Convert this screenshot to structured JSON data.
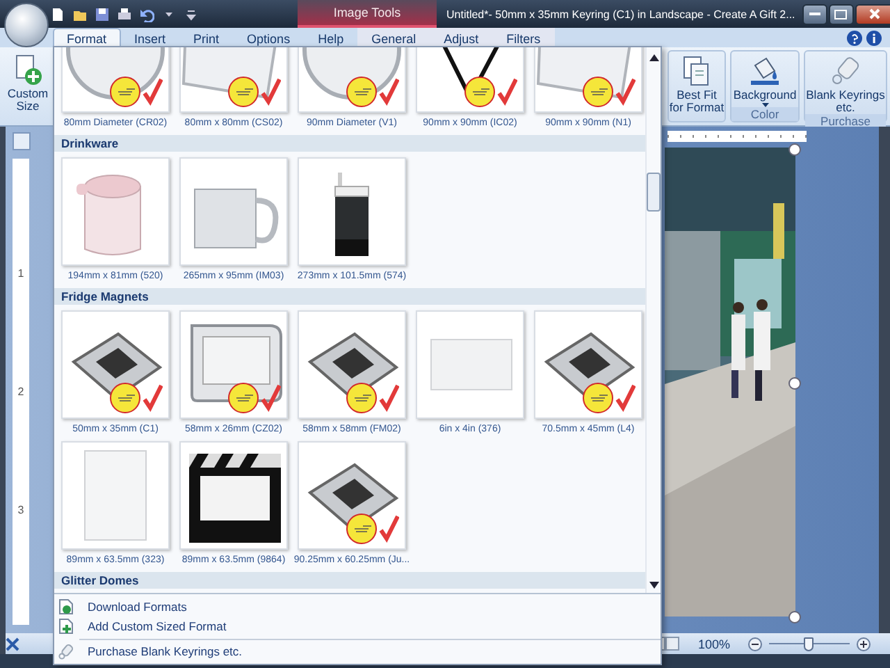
{
  "window": {
    "title": "Untitled*- 50mm x 35mm Keyring (C1) in Landscape - Create A Gift 2...",
    "context_label": "Image Tools"
  },
  "tabs": [
    {
      "label": "Format",
      "selected": true,
      "contextual": false
    },
    {
      "label": "Insert",
      "selected": false,
      "contextual": false
    },
    {
      "label": "Print",
      "selected": false,
      "contextual": false
    },
    {
      "label": "Options",
      "selected": false,
      "contextual": false
    },
    {
      "label": "Help",
      "selected": false,
      "contextual": false
    },
    {
      "label": "General",
      "selected": false,
      "contextual": true
    },
    {
      "label": "Adjust",
      "selected": false,
      "contextual": true
    },
    {
      "label": "Filters",
      "selected": false,
      "contextual": true
    }
  ],
  "ribbon": {
    "custom_size": "Custom Size",
    "groups": [
      {
        "buttons": [
          {
            "label": "Best Fit for Format",
            "dropdown": false
          }
        ]
      },
      {
        "label": "Color",
        "buttons": [
          {
            "label": "Background",
            "dropdown": true
          }
        ]
      },
      {
        "label": "Purchase",
        "buttons": [
          {
            "label": "Blank Keyrings etc.",
            "dropdown": false
          }
        ]
      }
    ]
  },
  "gallery": {
    "sections": [
      {
        "items": [
          {
            "label": "80mm Diameter (CR02)",
            "kind": "round",
            "badge": true
          },
          {
            "label": "80mm x 80mm (CS02)",
            "kind": "square",
            "badge": true
          },
          {
            "label": "90mm Diameter (V1)",
            "kind": "round",
            "badge": true
          },
          {
            "label": "90mm x 90mm (IC02)",
            "kind": "strap",
            "badge": true
          },
          {
            "label": "90mm x 90mm (N1)",
            "kind": "square",
            "badge": true
          }
        ]
      },
      {
        "title": "Drinkware",
        "items": [
          {
            "label": "194mm x 81mm (520)",
            "kind": "cup",
            "badge": false
          },
          {
            "label": "265mm x 95mm (IM03)",
            "kind": "mug",
            "badge": false
          },
          {
            "label": "273mm x 101.5mm (574)",
            "kind": "bottle",
            "badge": false
          }
        ]
      },
      {
        "title": "Fridge Magnets",
        "items": [
          {
            "label": "50mm x 35mm (C1)",
            "kind": "magnet",
            "badge": true
          },
          {
            "label": "58mm x 26mm (CZ02)",
            "kind": "frame",
            "badge": true
          },
          {
            "label": "58mm x 58mm (FM02)",
            "kind": "magnet",
            "badge": true
          },
          {
            "label": "6in x 4in (376)",
            "kind": "card",
            "badge": false
          },
          {
            "label": "70.5mm x 45mm (L4)",
            "kind": "magnet",
            "badge": true
          },
          {
            "label": "89mm x 63.5mm (323)",
            "kind": "portrait",
            "badge": false
          },
          {
            "label": "89mm x 63.5mm (9864)",
            "kind": "clapper",
            "badge": false
          },
          {
            "label": "90.25mm x 60.25mm (Ju...",
            "kind": "magnet",
            "badge": true
          }
        ]
      },
      {
        "title": "Glitter Domes"
      }
    ]
  },
  "menu": [
    {
      "label": "Download Formats",
      "divider_before": false
    },
    {
      "label": "Add Custom Sized Format",
      "divider_before": false
    },
    {
      "label": "Purchase Blank Keyrings etc.",
      "divider_before": true
    }
  ],
  "ruler": {
    "numbers": [
      "1",
      "2",
      "3"
    ]
  },
  "status_bar": {
    "zoom": "100%",
    "level": 0.5
  }
}
